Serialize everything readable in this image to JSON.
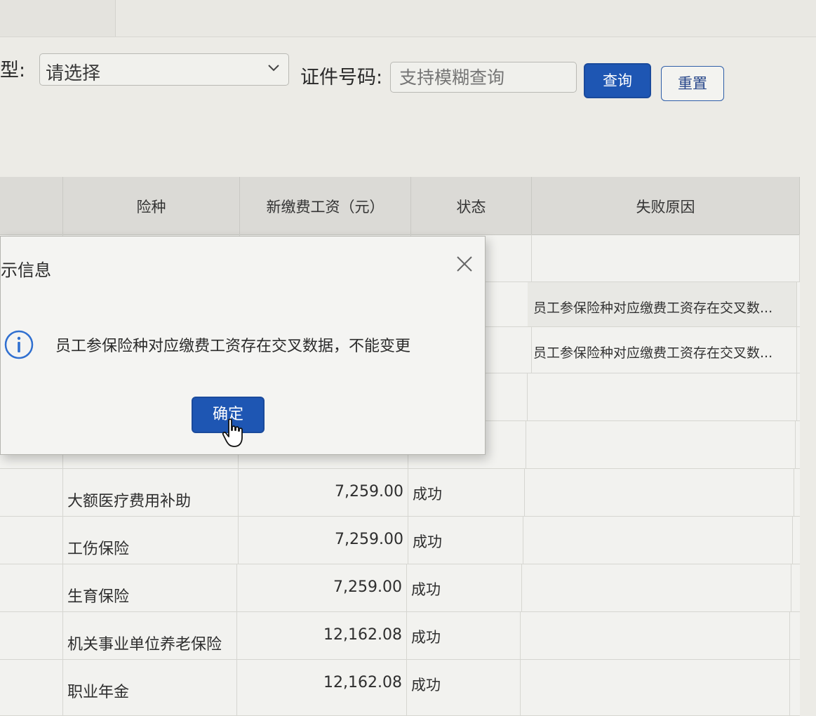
{
  "filter": {
    "type_label": "型:",
    "type_select_value": "请选择",
    "id_label": "证件号码:",
    "id_placeholder": "支持模糊查询",
    "query_button": "查询",
    "reset_button": "重置"
  },
  "table": {
    "headers": [
      "险种",
      "新缴费工资（元）",
      "状态",
      "失败原因"
    ],
    "rows": [
      {
        "insurance": "",
        "wage": "",
        "status": "",
        "reason": ""
      },
      {
        "insurance": "",
        "wage": "",
        "status": "",
        "reason": "员工参保险种对应缴费工资存在交叉数..."
      },
      {
        "insurance": "",
        "wage": "",
        "status": "",
        "reason": "员工参保险种对应缴费工资存在交叉数..."
      },
      {
        "insurance": "",
        "wage": "",
        "status": "",
        "reason": ""
      },
      {
        "insurance": "",
        "wage": "",
        "status": "",
        "reason": ""
      },
      {
        "insurance": "大额医疗费用补助",
        "wage": "7,259.00",
        "status": "成功",
        "reason": ""
      },
      {
        "insurance": "工伤保险",
        "wage": "7,259.00",
        "status": "成功",
        "reason": ""
      },
      {
        "insurance": "生育保险",
        "wage": "7,259.00",
        "status": "成功",
        "reason": ""
      },
      {
        "insurance": "机关事业单位养老保险",
        "wage": "12,162.08",
        "status": "成功",
        "reason": ""
      },
      {
        "insurance": "职业年金",
        "wage": "12,162.08",
        "status": "成功",
        "reason": ""
      }
    ]
  },
  "dialog": {
    "title": "示信息",
    "message": "员工参保险种对应缴费工资存在交叉数据，不能变更",
    "ok_button": "确定"
  },
  "icons": {
    "close": "close-icon",
    "info": "info-icon",
    "chevron": "chevron-down-icon",
    "cursor": "hand-pointer-icon"
  },
  "colors": {
    "primary": "#1e56b3",
    "info": "#2f6fd0"
  }
}
